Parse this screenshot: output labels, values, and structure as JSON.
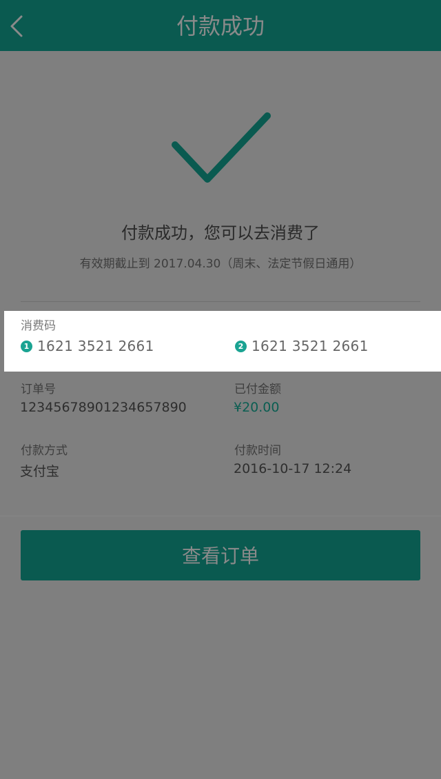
{
  "header": {
    "title": "付款成功",
    "back_icon": "chevron-left-icon"
  },
  "success": {
    "icon": "checkmark-icon",
    "title": "付款成功，您可以去消费了",
    "validity": "有效期截止到 2017.04.30（周末、法定节假日通用）"
  },
  "codes": {
    "label": "消费码",
    "items": [
      {
        "index": "1",
        "value": "1621 3521 2661"
      },
      {
        "index": "2",
        "value": "1621 3521 2661"
      }
    ]
  },
  "order": {
    "number_label": "订单号",
    "number_value": "12345678901234657890",
    "amount_label": "已付金额",
    "amount_value": "¥20.00",
    "method_label": "付款方式",
    "method_value": "支付宝",
    "time_label": "付款时间",
    "time_value": "2016-10-17 12:24"
  },
  "actions": {
    "view_order_label": "查看订单"
  },
  "colors": {
    "primary": "#0a5a50",
    "badge": "#1aa392",
    "overlay": "#7f7f7f"
  }
}
